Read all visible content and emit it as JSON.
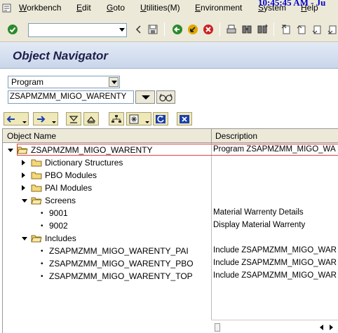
{
  "menubar": {
    "items": [
      "Workbench",
      "Edit",
      "Goto",
      "Utilities(M)",
      "Environment",
      "System",
      "Help"
    ],
    "clock": "10:45:45 AM - Ju"
  },
  "toolbar": {
    "command_value": "",
    "icons": [
      "enter-icon",
      "back-icon",
      "save-icon",
      "back-green-icon",
      "exit-icon",
      "cancel-icon",
      "print-icon",
      "find-icon",
      "find-next-icon",
      "first-page-icon",
      "previous-page-icon",
      "next-page-icon"
    ]
  },
  "title": "Object Navigator",
  "selection": {
    "object_type": "Program",
    "object_name": "ZSAPMZMM_MIGO_WARENTY"
  },
  "tree": {
    "columns": [
      "Object Name",
      "Description"
    ],
    "rows": [
      {
        "name": "ZSAPMZMM_MIGO_WARENTY",
        "desc": "Program ZSAPMZMM_MIGO_WA",
        "level": 0,
        "expand": "open",
        "type": "folder-open"
      },
      {
        "name": "Dictionary Structures",
        "desc": "",
        "level": 1,
        "expand": "closed",
        "type": "folder"
      },
      {
        "name": "PBO Modules",
        "desc": "",
        "level": 1,
        "expand": "closed",
        "type": "folder"
      },
      {
        "name": "PAI Modules",
        "desc": "",
        "level": 1,
        "expand": "closed",
        "type": "folder"
      },
      {
        "name": "Screens",
        "desc": "",
        "level": 1,
        "expand": "open",
        "type": "folder-open"
      },
      {
        "name": "9001",
        "desc": "Material Warrenty Details",
        "level": 2,
        "expand": "",
        "type": "leaf"
      },
      {
        "name": "9002",
        "desc": "Display Material Warrenty",
        "level": 2,
        "expand": "",
        "type": "leaf"
      },
      {
        "name": "Includes",
        "desc": "",
        "level": 1,
        "expand": "open",
        "type": "folder-open"
      },
      {
        "name": "ZSAPMZMM_MIGO_WARENTY_PAI",
        "desc": "Include ZSAPMZMM_MIGO_WAR",
        "level": 2,
        "expand": "",
        "type": "leaf"
      },
      {
        "name": "ZSAPMZMM_MIGO_WARENTY_PBO",
        "desc": "Include ZSAPMZMM_MIGO_WAR",
        "level": 2,
        "expand": "",
        "type": "leaf"
      },
      {
        "name": "ZSAPMZMM_MIGO_WARENTY_TOP",
        "desc": "Include ZSAPMZMM_MIGO_WAR",
        "level": 2,
        "expand": "",
        "type": "leaf"
      }
    ]
  }
}
